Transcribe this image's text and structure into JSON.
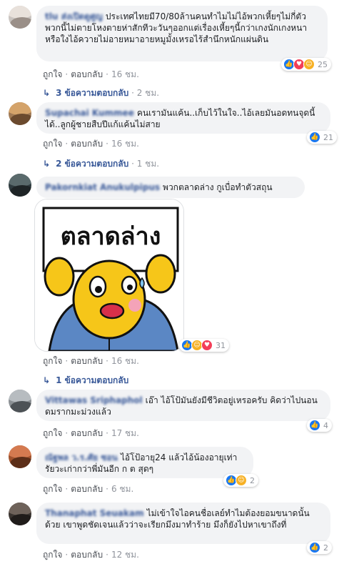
{
  "comments": [
    {
      "author": "tlu ส่งเปิดดูศูญ",
      "text": "ประเทศไทยมี70/80ล้านคนทำไมไม่ไอ้พวกเหี้ยๆไม่กี่ตัวพวกนี้ไม่ตายโหงตายห่าสักทีวะวันๆออกแต่เรื่องเหี้ยๆนี้กว่าเกงนักเกงหนาหรือใงไอ้ควายไม่อายหมาอายหมูมั้งเหรอไร้สำนึกหนักแผ่นดิน",
      "like": "ถูกใจ",
      "reply": "ตอบกลับ",
      "time": "16 ชม.",
      "reactions": "25",
      "replies": "3 ข้อความตอบกลับ",
      "replies_time": "2 ชม."
    },
    {
      "author": "Supachai Kummee",
      "text": "คนเรามันแค้น..เก็บไว้ในใจ..ไอ้เลยมันอดทนจุดนี้ได้..ลูกผู้ชายสืบปีแก้แค้นไม่สาย",
      "like": "ถูกใจ",
      "reply": "ตอบกลับ",
      "time": "16 ชม.",
      "reactions": "21",
      "replies": "2 ข้อความตอบกลับ",
      "replies_time": "1 ชม."
    },
    {
      "author": "Pakornkiat Anukulpipus",
      "text": "พวกตลาดล่าง กูเบื่อทำตัวสถุน",
      "sticker_sign": "ตลาดล่าง",
      "like": "ถูกใจ",
      "reply": "ตอบกลับ",
      "time": "16 ชม.",
      "reactions": "31",
      "replies": "1 ข้อความตอบกลับ"
    },
    {
      "author": "Vittawas Sriphaphol",
      "text": "เอ๊า ไอ้โป้มันยังมีชีวิตอยู่เหรอครับ คิดว่าไปนอนดมรากมะม่วงแล้ว",
      "like": "ถูกใจ",
      "reply": "ตอบกลับ",
      "time": "17 ชม.",
      "reactions": "4"
    },
    {
      "author": "ณัฐพล ว.ร.ศัย ซอน",
      "text": "ไอ้โป้อายุ24 แล้วไอ้น้องอายุเท่ารัยวะเก่ากว่าพี่มันอีก ก ต สุดๆ",
      "like": "ถูกใจ",
      "reply": "ตอบกลับ",
      "time": "6 ชม.",
      "reactions": "2"
    },
    {
      "author": "Thanaphat Seuakam",
      "text": "ไม่เข้าใจไอคนชื่อเลย์ทำไมต้องยอมขนาดนั้นด้วย เขาพูดชัดเจนแล้วว่าจะเรียกมึงมาทำร้าย มึงก็ยังไปหาเขาถึงที่",
      "like": "ถูกใจ",
      "reply": "ตอบกลับ",
      "time": "12 ชม.",
      "reactions": "2"
    }
  ],
  "icons": {
    "like": "thumbs-up-icon",
    "haha": "laughing-face-icon",
    "love": "heart-icon",
    "reply_arrow": "reply-arrow-icon"
  },
  "colors": {
    "name": "#385898",
    "bubble": "#f2f3f5",
    "meta": "#90949c",
    "like": "#1877f2",
    "haha": "#f7b125",
    "love": "#f33e58"
  }
}
